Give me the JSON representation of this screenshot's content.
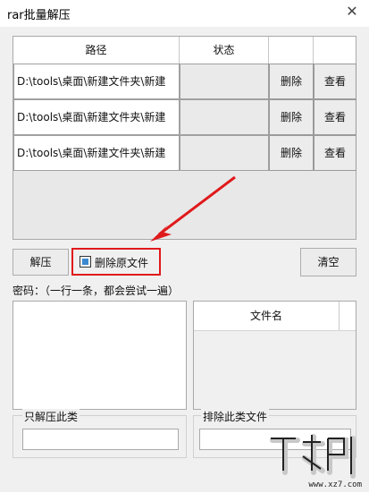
{
  "window": {
    "title": "rar批量解压",
    "close_glyph": "✕"
  },
  "table": {
    "headers": {
      "path": "路径",
      "status": "状态"
    },
    "rows": [
      {
        "path": "D:\\tools\\桌面\\新建文件夹\\新建",
        "status": "",
        "delete_label": "删除",
        "view_label": "查看"
      },
      {
        "path": "D:\\tools\\桌面\\新建文件夹\\新建",
        "status": "",
        "delete_label": "删除",
        "view_label": "查看"
      },
      {
        "path": "D:\\tools\\桌面\\新建文件夹\\新建",
        "status": "",
        "delete_label": "删除",
        "view_label": "查看"
      }
    ]
  },
  "actions": {
    "extract_label": "解压",
    "delete_original_label": "删除原文件",
    "delete_original_checked": true,
    "clear_label": "清空"
  },
  "password": {
    "label": "密码：（一行一条，都会尝试一遍）",
    "value": ""
  },
  "file_list": {
    "header": "文件名"
  },
  "filters": {
    "only_extract_label": "只解压此类",
    "only_extract_value": "",
    "exclude_label": "排除此类文件",
    "exclude_value": ""
  },
  "colors": {
    "highlight_red": "#e0191b",
    "checkbox_blue": "#3c89d0",
    "background": "#f0f0f0"
  },
  "watermark": {
    "text": "www.xz7.com"
  }
}
